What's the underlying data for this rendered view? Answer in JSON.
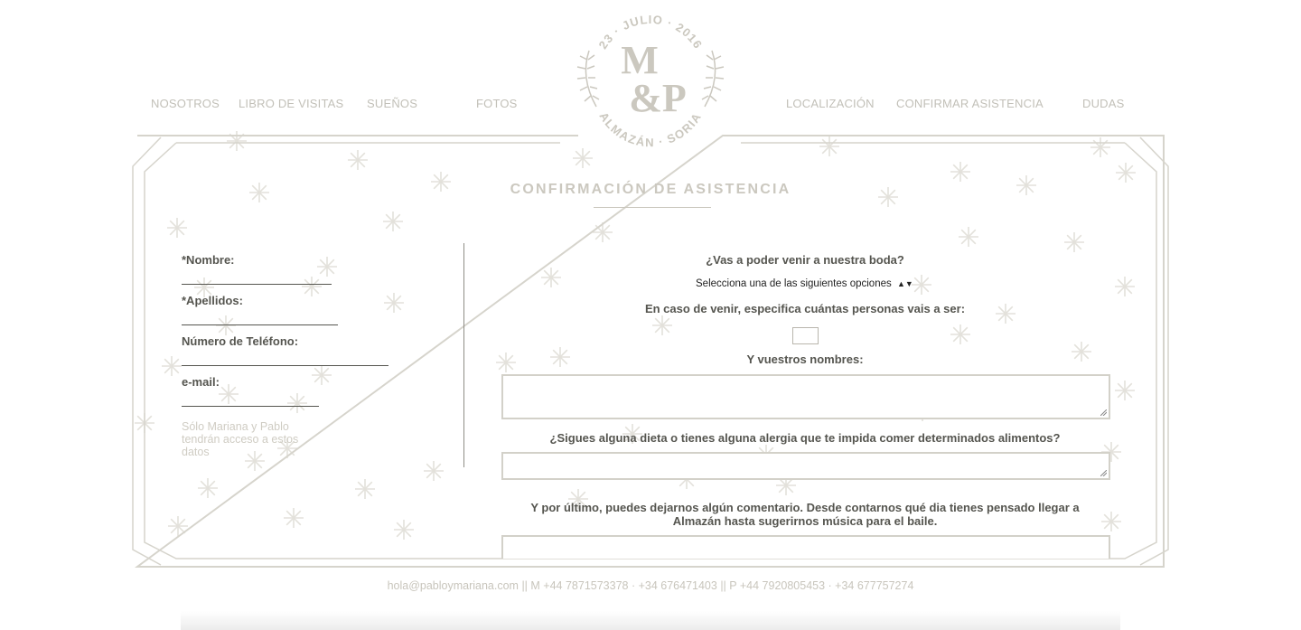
{
  "nav": {
    "left": [
      "NOSOTROS",
      "LIBRO DE VISITAS",
      "SUEÑOS",
      "FOTOS"
    ],
    "right": [
      "LOCALIZACIÓN",
      "CONFIRMAR ASISTENCIA",
      "DUDAS"
    ]
  },
  "logo": {
    "date": "23 · JULIO · 2016",
    "initials_top": "M",
    "initials_bottom": "&P",
    "place": "ALMAZÁN · SORIA"
  },
  "page": {
    "title": "CONFIRMACIÓN DE ASISTENCIA"
  },
  "contact_form": {
    "name_label": "*Nombre:",
    "surname_label": "*Apellidos:",
    "phone_label": "Número de Teléfono:",
    "email_label": "e-mail:",
    "privacy_note": "Sólo Mariana y Pablo tendrán acceso a estos datos"
  },
  "rsvp_form": {
    "attend_question": "¿Vas a poder venir a nuestra boda?",
    "attend_select_value": "Selecciona una de las siguientes opciones",
    "guests_question": "En caso de venir, especifica cuántas personas vais a ser:",
    "names_question": "Y vuestros nombres:",
    "diet_question": "¿Sigues alguna dieta o tienes alguna alergia que te impida comer determinados alimentos?",
    "comment_question": "Y por último, puedes dejarnos algún comentario. Desde contarnos qué dia tienes pensado llegar a Almazán hasta sugerirnos música para el baile."
  },
  "footer": {
    "contact": "hola@pabloymariana.com || M +44 7871573378 · +34 676471403 || P +44 7920805453 · +34 677757274"
  },
  "colors": {
    "nav_text": "#c2c0b8",
    "frame": "#d6d4cc",
    "label_text": "#55554f",
    "muted_text": "#cfccc3"
  }
}
